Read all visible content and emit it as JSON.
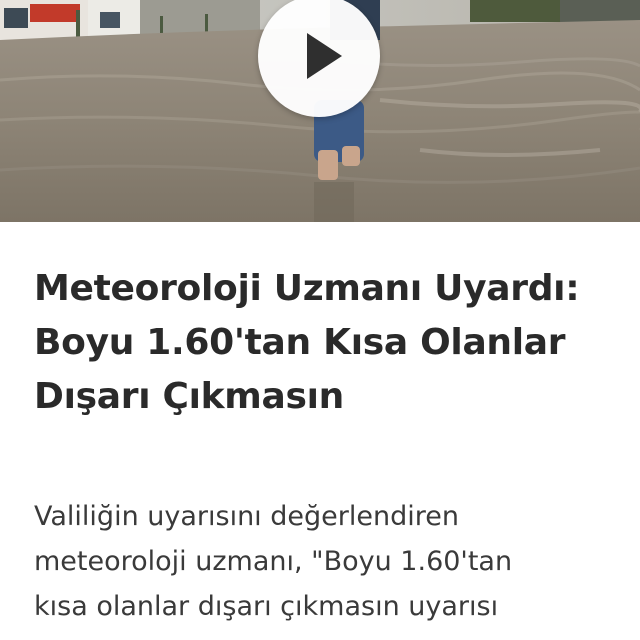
{
  "video": {
    "thumbnail_icon": "play-icon",
    "thumbnail_description_colors": {
      "water": "#8a8173",
      "sky": "#d9d9d6",
      "jeans": "#3c5a86"
    }
  },
  "article": {
    "headline_lines": [
      "Meteoroloji Uzmanı Uyardı:",
      "Boyu 1.60'tan Kısa Olanlar",
      "Dışarı Çıkmasın"
    ],
    "body_lines": [
      "Valiliğin uyarısını değerlendiren",
      "meteoroloji uzmanı, \"Boyu 1.60'tan",
      "kısa olanlar dışarı çıkmasın uyarısı"
    ]
  },
  "colors": {
    "headline": "#2a2a2a",
    "body": "#3a3a3a",
    "background": "#ffffff"
  }
}
